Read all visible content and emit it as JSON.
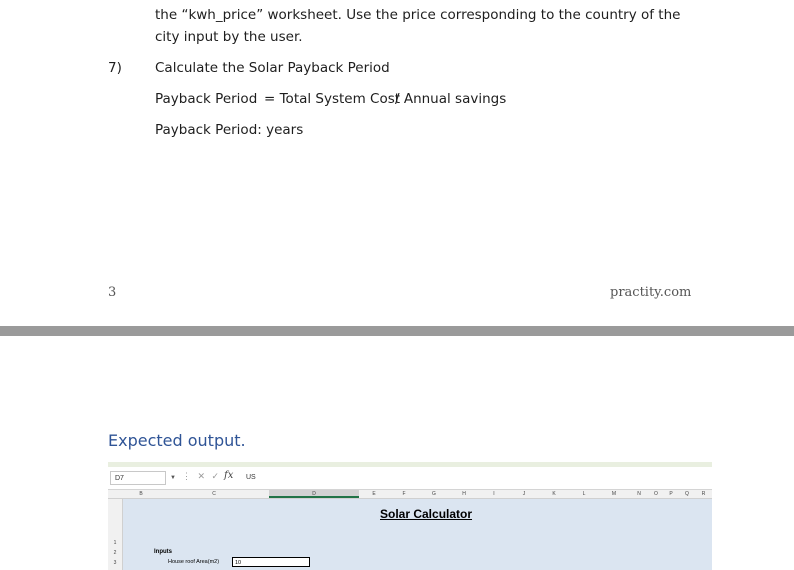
{
  "doc": {
    "line_top": "the “kwh_price” worksheet. Use the price corresponding to the country of the",
    "line_cont": "city input by the user.",
    "step_number": "7)",
    "step_text": "Calculate the Solar Payback Period",
    "formula_label": "Payback Period",
    "formula_eq": "= Total System Cost",
    "formula_div": "/ Annual savings",
    "result_label": "Payback Period: years",
    "page_number": "3",
    "footer_site": "practity.com",
    "expected_heading": "Expected output."
  },
  "excel": {
    "name_box": "D7",
    "formula_value": "US",
    "fx_label": "fx",
    "columns": [
      "B",
      "C",
      "D",
      "E",
      "F",
      "G",
      "H",
      "I",
      "J",
      "K",
      "L",
      "M",
      "N",
      "O",
      "P",
      "Q",
      "R"
    ],
    "rows": [
      "1",
      "2",
      "3"
    ],
    "title": "Solar Calculator",
    "inputs_label": "Inputs",
    "house_label": "House roof Area(m2)",
    "house_value": "10",
    "colors": {
      "sheet_bg": "#dbe5f1",
      "selected_col": "#217346"
    }
  }
}
